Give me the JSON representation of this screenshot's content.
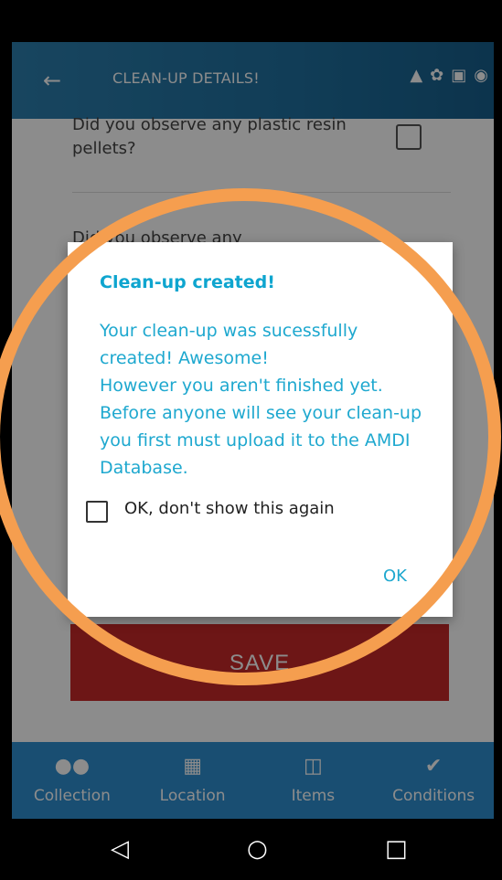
{
  "app": {
    "title": "CLEAN-UP DETAILS!",
    "back_icon": "arrow-left-icon",
    "logo_icons": [
      "map-icon",
      "turtle-icon",
      "trash-icon",
      "globe-icon"
    ]
  },
  "form": {
    "question_1": "Did you observe any plastic resin pellets?",
    "question_2": "Did you observe any",
    "save_label": "SAVE"
  },
  "dialog": {
    "title": "Clean-up created!",
    "message": "Your clean-up was sucessfully created! Awesome!\nHowever you aren't finished yet. Before anyone will see your clean-up you first must upload it to the AMDI Database.",
    "checkbox_label": "OK, don't show this again",
    "ok_label": "OK"
  },
  "bottom_nav": {
    "items": [
      {
        "label": "Collection",
        "icon": "people-icon"
      },
      {
        "label": "Location",
        "icon": "map-icon"
      },
      {
        "label": "Items",
        "icon": "clipboard-icon"
      },
      {
        "label": "Conditions",
        "icon": "check-circle-icon"
      }
    ],
    "active": "Conditions"
  },
  "colors": {
    "appbar": "#2c7fae",
    "dialog_text": "#1ea8cf",
    "save_button": "#c62828",
    "bottom_nav": "#2e8fd0",
    "highlight_ring": "#f59e4f"
  }
}
